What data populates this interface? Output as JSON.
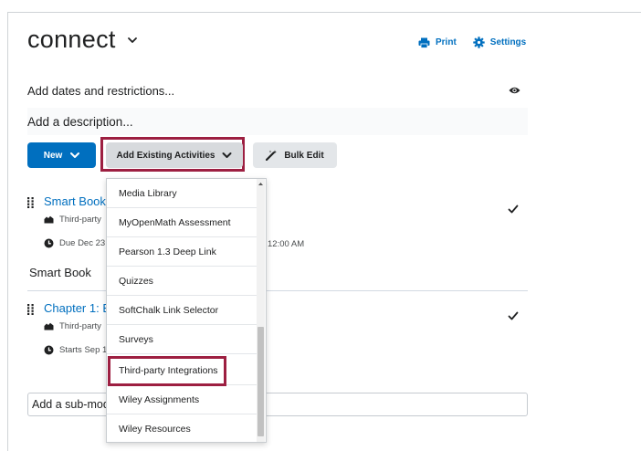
{
  "module": {
    "title": "connect"
  },
  "actions": {
    "print": "Print",
    "settings": "Settings"
  },
  "dates_row": {
    "label": "Add dates and restrictions..."
  },
  "description_row": {
    "label": "Add a description..."
  },
  "toolbar": {
    "new_label": "New",
    "add_existing_label": "Add Existing Activities",
    "bulk_edit_label": "Bulk Edit"
  },
  "items": [
    {
      "name": "Smart Book",
      "type": "Third-party",
      "date": "Due Dec 23,",
      "time": "12:00 AM",
      "description": "Smart Book"
    },
    {
      "name": "Chapter 1: B",
      "type": "Third-party",
      "date": "Starts Sep 19"
    }
  ],
  "submodule": {
    "label": "Add a sub-mod"
  },
  "dropdown": {
    "items": [
      "Media Library",
      "MyOpenMath Assessment",
      "Pearson 1.3 Deep Link",
      "Quizzes",
      "SoftChalk Link Selector",
      "Surveys",
      "Third-party Integrations",
      "Wiley Assignments",
      "Wiley Resources"
    ]
  },
  "colors": {
    "accent": "#006fbf",
    "highlight": "#9d1f41"
  }
}
